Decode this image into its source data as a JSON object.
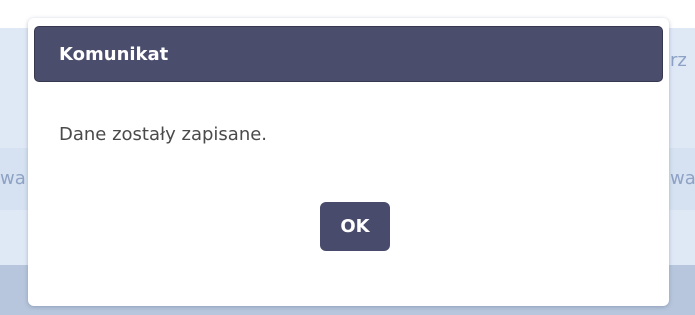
{
  "background": {
    "fragment_top_right": "rz",
    "fragment_mid_left": "wa",
    "fragment_mid_right": "wa"
  },
  "dialog": {
    "title": "Komunikat",
    "message": "Dane zostały zapisane.",
    "ok_label": "OK"
  },
  "colors": {
    "header_bg": "#4b4d6d",
    "button_bg": "#484b6b",
    "page_bg": "#dfe9f6"
  }
}
